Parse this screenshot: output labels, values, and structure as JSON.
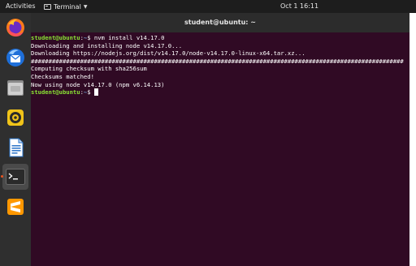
{
  "topbar": {
    "activities": "Activities",
    "app_menu": "Terminal",
    "clock": "Oct 1  16:11"
  },
  "dock": {
    "items": [
      {
        "name": "firefox",
        "icon": "firefox-icon"
      },
      {
        "name": "thunderbird",
        "icon": "thunderbird-icon"
      },
      {
        "name": "files",
        "icon": "folder-icon"
      },
      {
        "name": "rhythmbox",
        "icon": "speaker-icon"
      },
      {
        "name": "libreoffice-writer",
        "icon": "writer-icon"
      },
      {
        "name": "terminal",
        "icon": "terminal-icon",
        "active": true
      },
      {
        "name": "sublime-text",
        "icon": "sublime-icon"
      }
    ]
  },
  "window": {
    "title": "student@ubuntu: ~"
  },
  "terminal": {
    "prompt_user": "student@ubuntu",
    "prompt_sep": ":",
    "prompt_path": "~",
    "prompt_symbol": "$ ",
    "command": "nvm install v14.17.0",
    "output": [
      "Downloading and installing node v14.17.0...",
      "Downloading https://nodejs.org/dist/v14.17.0/node-v14.17.0-linux-x64.tar.xz...",
      "##########################################################################################################",
      "Computing checksum with sha256sum",
      "Checksums matched!",
      "Now using node v14.17.0 (npm v6.14.13)"
    ]
  },
  "colors": {
    "terminal_bg": "#300a24",
    "prompt_user": "#8ae234",
    "prompt_path": "#729fcf",
    "dock_bg": "#2f2f2f",
    "topbar_bg": "#1d1d1d",
    "accent": "#e95420"
  }
}
